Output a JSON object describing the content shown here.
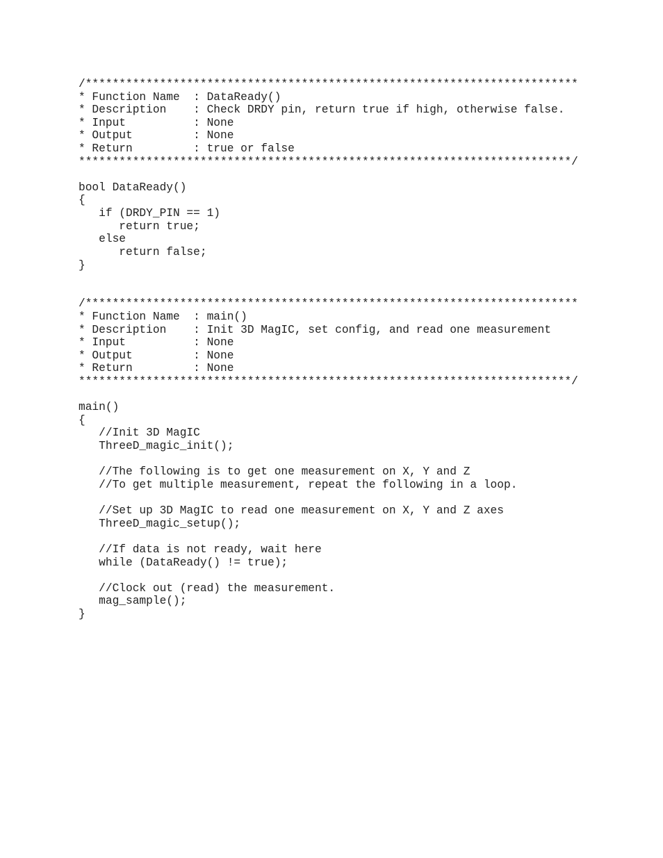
{
  "document": {
    "blocks": [
      {
        "id": "dataready-header",
        "kind": "comment-header",
        "lines": [
          "/*************************************************************************",
          "* Function Name  : DataReady()",
          "* Description    : Check DRDY pin, return true if high, otherwise false.",
          "* Input          : None",
          "* Output         : None",
          "* Return         : true or false",
          "*************************************************************************/"
        ]
      },
      {
        "id": "blank-1",
        "kind": "blank",
        "lines": [
          ""
        ]
      },
      {
        "id": "dataready-function",
        "kind": "code",
        "lines": [
          "bool DataReady()",
          "{",
          "   if (DRDY_PIN == 1)",
          "      return true;",
          "   else",
          "      return false;",
          "}"
        ]
      },
      {
        "id": "blank-2",
        "kind": "blank",
        "lines": [
          "",
          ""
        ]
      },
      {
        "id": "main-header",
        "kind": "comment-header",
        "lines": [
          "/*************************************************************************",
          "* Function Name  : main()",
          "* Description    : Init 3D MagIC, set config, and read one measurement",
          "* Input          : None",
          "* Output         : None",
          "* Return         : None",
          "*************************************************************************/"
        ]
      },
      {
        "id": "blank-3",
        "kind": "blank",
        "lines": [
          ""
        ]
      },
      {
        "id": "main-function",
        "kind": "code",
        "lines": [
          "main()",
          "{",
          "   //Init 3D MagIC",
          "   ThreeD_magic_init();",
          "",
          "   //The following is to get one measurement on X, Y and Z",
          "   //To get multiple measurement, repeat the following in a loop.",
          "",
          "   //Set up 3D MagIC to read one measurement on X, Y and Z axes",
          "   ThreeD_magic_setup();",
          "",
          "   //If data is not ready, wait here",
          "   while (DataReady() != true);",
          "",
          "   //Clock out (read) the measurement.",
          "   mag_sample();",
          "}"
        ]
      }
    ]
  }
}
